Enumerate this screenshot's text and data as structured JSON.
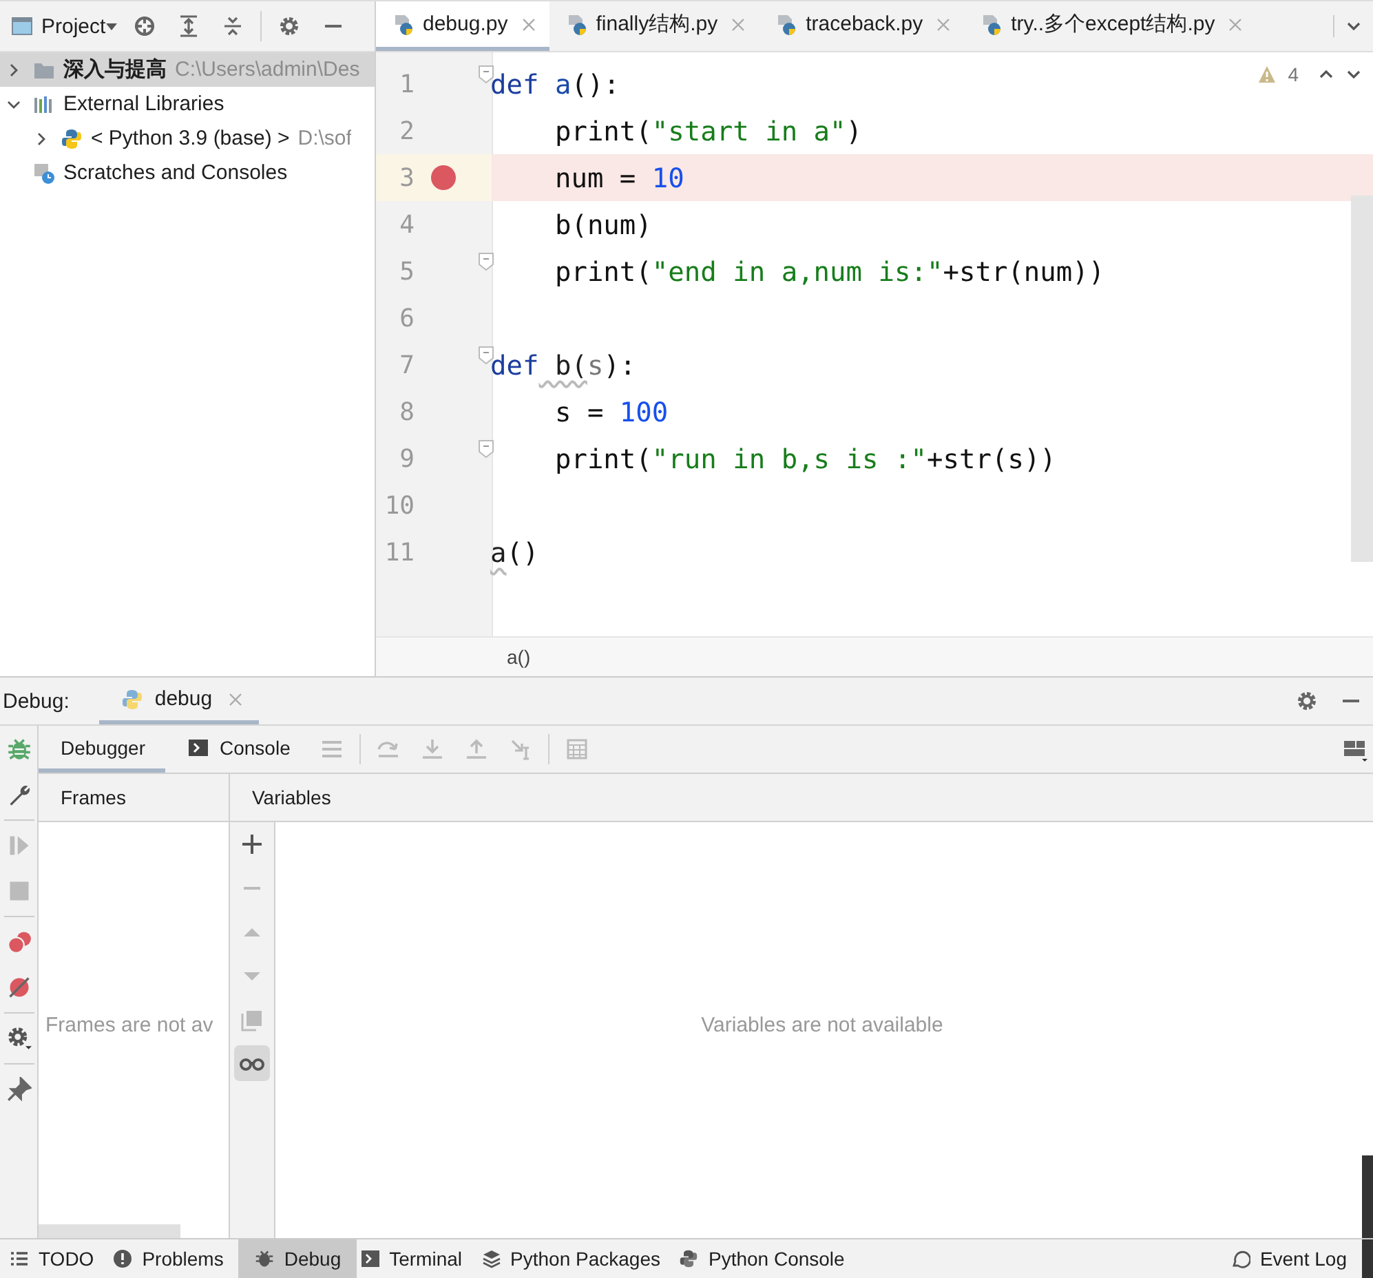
{
  "project_panel": {
    "title": "Project",
    "tree": [
      {
        "label": "深入与提高",
        "path": "C:\\Users\\admin\\Des",
        "kind": "folder",
        "bold": true,
        "selected": true,
        "expanded": false
      },
      {
        "label": "External Libraries",
        "kind": "library",
        "bold": false,
        "selected": false,
        "expanded": true,
        "children": [
          {
            "label": "< Python 3.9 (base) >",
            "path": "D:\\sof",
            "kind": "python",
            "bold": false,
            "selected": false,
            "expanded": false
          }
        ]
      },
      {
        "label": "Scratches and Consoles",
        "kind": "scratches",
        "bold": false,
        "selected": false
      }
    ]
  },
  "editor": {
    "tabs": [
      {
        "label": "debug.py",
        "selected": true
      },
      {
        "label": "finally结构.py",
        "selected": false
      },
      {
        "label": "traceback.py",
        "selected": false
      },
      {
        "label": "try..多个except结构.py",
        "selected": false
      }
    ],
    "warnings": "4",
    "lines": [
      {
        "number": "1",
        "fold": true,
        "breakpoint": false,
        "tokens": [
          {
            "t": "def",
            "kind": "kw"
          },
          {
            "t": " a",
            "kind": "fn"
          },
          {
            "t": "():",
            "kind": "plain"
          }
        ]
      },
      {
        "number": "2",
        "fold": false,
        "breakpoint": false,
        "tokens": [
          {
            "t": "    print(",
            "kind": "plain"
          },
          {
            "t": "\"start in a\"",
            "kind": "str"
          },
          {
            "t": ")",
            "kind": "plain"
          }
        ]
      },
      {
        "number": "3",
        "fold": false,
        "breakpoint": true,
        "tokens": [
          {
            "t": "    num = ",
            "kind": "plain"
          },
          {
            "t": "10",
            "kind": "num"
          }
        ]
      },
      {
        "number": "4",
        "fold": false,
        "breakpoint": false,
        "tokens": [
          {
            "t": "    b(num)",
            "kind": "plain"
          }
        ]
      },
      {
        "number": "5",
        "fold": true,
        "breakpoint": false,
        "tokens": [
          {
            "t": "    print(",
            "kind": "plain"
          },
          {
            "t": "\"end in a,num is:\"",
            "kind": "str"
          },
          {
            "t": "+str(num))",
            "kind": "plain"
          }
        ]
      },
      {
        "number": "6",
        "fold": false,
        "breakpoint": false
      },
      {
        "number": "7",
        "fold": true,
        "breakpoint": false,
        "tokens": [
          {
            "t": "def",
            "kind": "kw"
          },
          {
            "t": " b(",
            "kind": "warn"
          },
          {
            "t": "s",
            "kind": "param"
          },
          {
            "t": "):",
            "kind": "plain"
          }
        ]
      },
      {
        "number": "8",
        "fold": false,
        "breakpoint": false,
        "tokens": [
          {
            "t": "    s = ",
            "kind": "plain"
          },
          {
            "t": "100",
            "kind": "num"
          }
        ]
      },
      {
        "number": "9",
        "fold": true,
        "breakpoint": false,
        "tokens": [
          {
            "t": "    print(",
            "kind": "plain"
          },
          {
            "t": "\"run in b,s is :\"",
            "kind": "str"
          },
          {
            "t": "+str(s))",
            "kind": "plain"
          }
        ]
      },
      {
        "number": "10",
        "fold": false,
        "breakpoint": false
      },
      {
        "number": "11",
        "fold": false,
        "breakpoint": false,
        "tokens": [
          {
            "t": "a",
            "kind": "warn"
          },
          {
            "t": "()",
            "kind": "plain"
          }
        ]
      }
    ],
    "breadcrumb": "a()"
  },
  "debug_panel": {
    "label": "Debug:",
    "session_tab": "debug",
    "tabs": [
      {
        "label": "Debugger",
        "kind": "plain",
        "selected": true
      },
      {
        "label": "Console",
        "kind": "console",
        "selected": false
      }
    ],
    "frames": {
      "title": "Frames",
      "empty": "Frames are not av"
    },
    "variables": {
      "title": "Variables",
      "empty": "Variables are not available"
    }
  },
  "bottom_bar": {
    "items": [
      {
        "label": "TODO",
        "kind": "list",
        "selected": false
      },
      {
        "label": "Problems",
        "kind": "problems",
        "selected": false
      },
      {
        "label": "Debug",
        "kind": "bug",
        "selected": true
      },
      {
        "label": "Terminal",
        "kind": "terminal",
        "selected": false
      },
      {
        "label": "Python Packages",
        "kind": "layers",
        "selected": false
      },
      {
        "label": "Python Console",
        "kind": "python",
        "selected": false
      }
    ],
    "right_item": {
      "label": "Event Log"
    }
  }
}
